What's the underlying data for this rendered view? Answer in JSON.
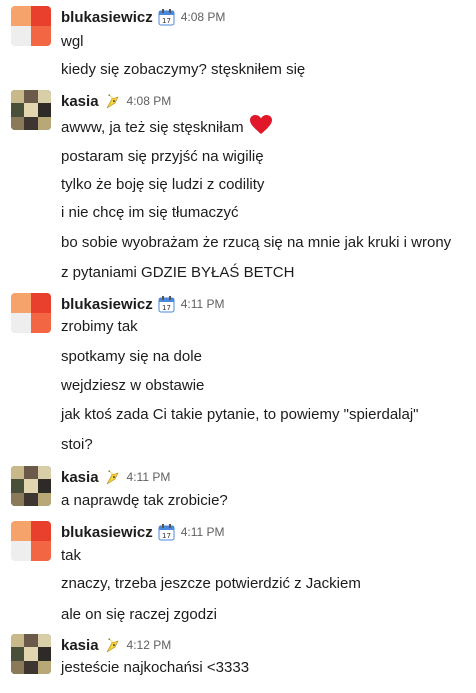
{
  "colors": {
    "author": "#1d1c1d",
    "timestamp": "#616061",
    "heart": "#e0182a"
  },
  "groups": [
    {
      "author": "blukasiewicz",
      "avatar": "slack-logo-avatar",
      "status_icon": "calendar-icon",
      "time": "4:08 PM",
      "messages": [
        "wgl",
        "kiedy się zobaczymy? stęskniłem się"
      ]
    },
    {
      "author": "kasia",
      "avatar": "photo-collage-avatar",
      "status_icon": "pikachu-icon",
      "time": "4:08 PM",
      "messages": [
        "awww, ja też się stęskniłam",
        "postaram się przyjść na wigilię",
        "tylko że boję się ludzi z codility",
        "i nie chcę im się tłumaczyć",
        "bo sobie wyobrażam że rzucą się na mnie jak kruki i wrony",
        "z pytaniami GDZIE BYŁAŚ BETCH"
      ]
    },
    {
      "author": "blukasiewicz",
      "avatar": "slack-logo-avatar",
      "status_icon": "calendar-icon",
      "time": "4:11 PM",
      "messages": [
        "zrobimy tak",
        "spotkamy się na dole",
        "wejdziesz w obstawie",
        "jak ktoś zada Ci takie pytanie, to powiemy \"spierdalaj\"",
        "stoi?"
      ]
    },
    {
      "author": "kasia",
      "avatar": "photo-collage-avatar",
      "status_icon": "pikachu-icon",
      "time": "4:11 PM",
      "messages": [
        "a naprawdę tak zrobicie?"
      ]
    },
    {
      "author": "blukasiewicz",
      "avatar": "slack-logo-avatar",
      "status_icon": "calendar-icon",
      "time": "4:11 PM",
      "messages": [
        "tak",
        "znaczy, trzeba jeszcze potwierdzić z Jackiem",
        "ale on się raczej zgodzi"
      ]
    },
    {
      "author": "kasia",
      "avatar": "photo-collage-avatar",
      "status_icon": "pikachu-icon",
      "time": "4:12 PM",
      "messages": [
        "jesteście najkochańsi <3333"
      ]
    }
  ]
}
